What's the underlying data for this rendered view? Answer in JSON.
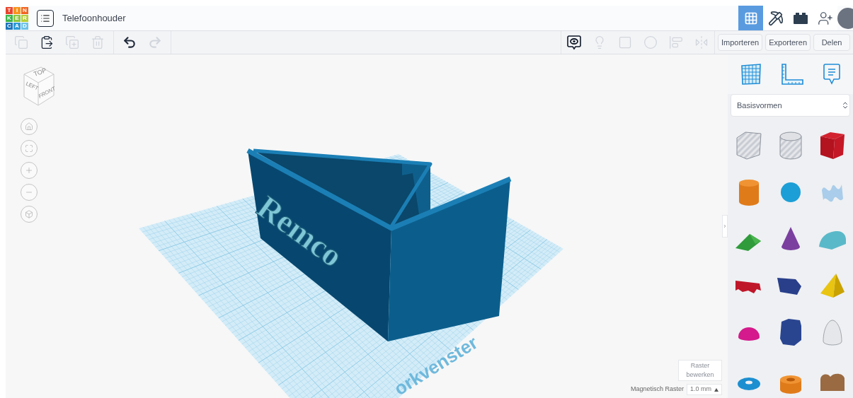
{
  "header": {
    "logo_letters": [
      {
        "char": "T",
        "color": "#e8452c"
      },
      {
        "char": "I",
        "color": "#f7941d"
      },
      {
        "char": "N",
        "color": "#f26522"
      },
      {
        "char": "K",
        "color": "#3cb54a"
      },
      {
        "char": "E",
        "color": "#8dc63f"
      },
      {
        "char": "R",
        "color": "#b5cf3a"
      },
      {
        "char": "C",
        "color": "#1c75bc"
      },
      {
        "char": "A",
        "color": "#2e9bd6"
      },
      {
        "char": "D",
        "color": "#6dc3e8"
      }
    ],
    "title": "Telefoonhouder",
    "views": [
      {
        "kind": "grid",
        "selected": true
      },
      {
        "kind": "pickaxe",
        "selected": false
      },
      {
        "kind": "bricks",
        "selected": false
      }
    ]
  },
  "toolbar": {
    "edit_tools": [
      {
        "kind": "copy",
        "disabled": true
      },
      {
        "kind": "paste",
        "disabled": false
      },
      {
        "kind": "duplicate",
        "disabled": true
      },
      {
        "kind": "delete",
        "disabled": true
      }
    ],
    "history_tools": [
      {
        "kind": "undo",
        "disabled": false
      },
      {
        "kind": "redo",
        "disabled": true
      }
    ],
    "shape_tools": [
      {
        "kind": "notes",
        "disabled": false
      },
      {
        "kind": "bulb",
        "disabled": true
      },
      {
        "kind": "solid",
        "disabled": true
      },
      {
        "kind": "hole",
        "disabled": true
      },
      {
        "kind": "align",
        "disabled": true
      },
      {
        "kind": "mirror",
        "disabled": true
      }
    ],
    "actions": [
      "Importeren",
      "Exporteren",
      "Delen"
    ]
  },
  "viewport": {
    "view_cube": {
      "top": "TOP",
      "left": "LEFT",
      "front": "FRONT"
    },
    "model_text": "Remco",
    "workplane_label": "orkvenster",
    "edit_grid_button": "Raster bewerken",
    "snap_grid": {
      "label": "Magnetisch Raster",
      "value": "1.0 mm"
    }
  },
  "panel": {
    "tools": [
      {
        "kind": "workplane"
      },
      {
        "kind": "ruler"
      },
      {
        "kind": "notes"
      }
    ],
    "library": "Basisvormen"
  }
}
